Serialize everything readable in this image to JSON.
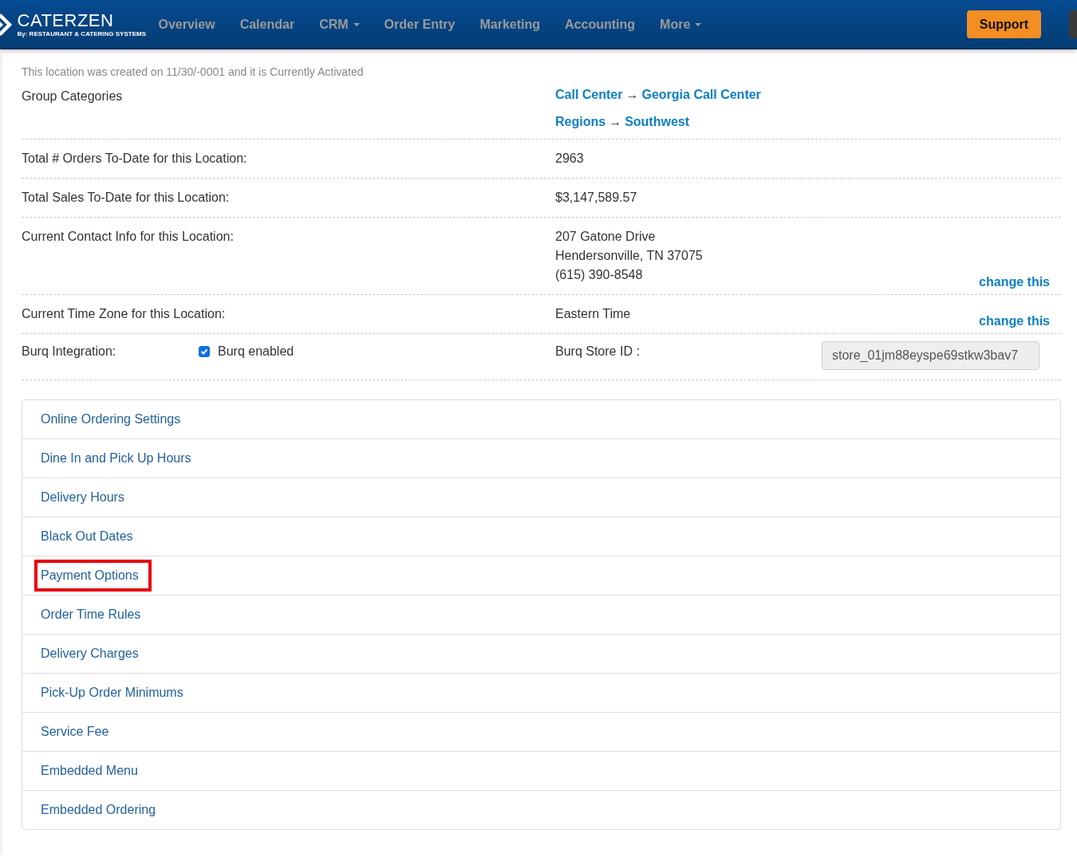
{
  "header": {
    "logo": {
      "name": "CATERZEN",
      "tagline": "By: RESTAURANT & CATERING SYSTEMS"
    },
    "nav": [
      {
        "label": "Overview",
        "dropdown": false
      },
      {
        "label": "Calendar",
        "dropdown": false
      },
      {
        "label": "CRM",
        "dropdown": true
      },
      {
        "label": "Order Entry",
        "dropdown": false
      },
      {
        "label": "Marketing",
        "dropdown": false
      },
      {
        "label": "Accounting",
        "dropdown": false
      },
      {
        "label": "More",
        "dropdown": true
      }
    ],
    "support_button": "Support"
  },
  "created_note": "This location was created on 11/30/-0001 and it is Currently Activated",
  "info_rows": [
    {
      "kind": "categories",
      "label": "Group Categories",
      "categories": [
        {
          "parent": "Call Center",
          "arrow": "→",
          "child": "Georgia Call Center"
        },
        {
          "parent": "Regions",
          "arrow": "→",
          "child": "Southwest"
        }
      ]
    },
    {
      "kind": "text",
      "label": "Total # Orders To-Date for this Location:",
      "lines": [
        "2963"
      ]
    },
    {
      "kind": "text",
      "label": "Total Sales To-Date for this Location:",
      "lines": [
        "$3,147,589.57"
      ]
    },
    {
      "kind": "text",
      "label": "Current Contact Info for this Location:",
      "lines": [
        "207 Gatone Drive",
        "Hendersonville, TN 37075",
        "(615) 390-8548"
      ],
      "link": "change this"
    },
    {
      "kind": "text",
      "label": "Current Time Zone for this Location:",
      "lines": [
        "Eastern Time"
      ],
      "link": "change this"
    },
    {
      "kind": "burq",
      "label": "Burq Integration:",
      "checkbox": {
        "label": "Burq enabled",
        "checked": true
      },
      "store_label": "Burq Store ID :",
      "store_value": "store_01jm88eyspe69stkw3bav7"
    }
  ],
  "settings_links": [
    {
      "label": "Online Ordering Settings",
      "highlighted": false
    },
    {
      "label": "Dine In and Pick Up Hours",
      "highlighted": false
    },
    {
      "label": "Delivery Hours",
      "highlighted": false
    },
    {
      "label": "Black Out Dates",
      "highlighted": false
    },
    {
      "label": "Payment Options",
      "highlighted": true
    },
    {
      "label": "Order Time Rules",
      "highlighted": false
    },
    {
      "label": "Delivery Charges",
      "highlighted": false
    },
    {
      "label": "Pick-Up Order Minimums",
      "highlighted": false
    },
    {
      "label": "Service Fee",
      "highlighted": false
    },
    {
      "label": "Embedded Menu",
      "highlighted": false
    },
    {
      "label": "Embedded Ordering",
      "highlighted": false
    }
  ]
}
